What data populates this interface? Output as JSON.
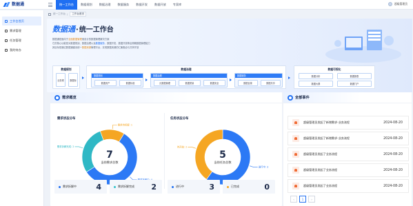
{
  "app": {
    "logo_text": "数据通"
  },
  "topnav": {
    "items": [
      "统一工作台",
      "数据规划",
      "数据治理",
      "数据服务",
      "数据开发",
      "数据开放",
      "专家库"
    ],
    "active_index": 0
  },
  "user": {
    "name": "超级管理员"
  },
  "sidebar": {
    "items": [
      {
        "label": "工作台首页",
        "icon": "home-icon",
        "active": true
      },
      {
        "label": "需求管理",
        "icon": "clipboard-icon",
        "active": false
      },
      {
        "label": "任务管理",
        "icon": "task-icon",
        "active": false
      },
      {
        "label": "我的待办",
        "icon": "todo-icon",
        "active": false
      }
    ]
  },
  "breadcrumb": {
    "items": [
      "统一工作台",
      "/"
    ],
    "current": "工作台首页"
  },
  "hero": {
    "title_main": "数据通",
    "title_sep": "·",
    "title_rest": "统一工作台",
    "desc_line1_a": "数据通是面向于",
    "desc_line1_hl": "全面数据管理",
    "desc_line1_b": "而设计的数据管理解决方案",
    "desc_line2_a": "它的核心功能是对数据规划、数据治理以及",
    "desc_line2_hl": "数据服务",
    "desc_line2_b": "、数据开发、数据开放等全周期数据管理能力",
    "desc_line3_a": "其目标是通过数据通建设统一",
    "desc_line3_hl": "数据资源",
    "desc_line3_b": "管理平台，实现数据资源的汇聚融合与共享开放",
    "flow": {
      "planning": {
        "title": "数据规划",
        "boxes": [
          "业务规划",
          "数据标准"
        ]
      },
      "governance_title": "数据治理",
      "sub1": {
        "title": "数据规划",
        "boxes": [
          "数据资产",
          "数据标准"
        ]
      },
      "sub2": {
        "title": "数据治理",
        "boxes": [
          "元数据管理",
          "数据质量",
          "数据安全"
        ]
      },
      "sub3": {
        "title": "数据服务",
        "boxes": [
          "数据目录",
          "数据共享"
        ]
      },
      "visible": {
        "title": "数据可视化",
        "boxes": [
          "数据分析",
          "数据大屏",
          "数据报表",
          "数据门户"
        ]
      }
    }
  },
  "overview": {
    "card_title": "需求概览",
    "demand_chart_title": "需求状态分布",
    "task_chart_title": "任务状态分布",
    "stats": [
      {
        "label": "需求拆解中",
        "value": "4",
        "color": "#1f6ff2"
      },
      {
        "label": "需求拆解完成",
        "value": "2",
        "color": "#2fc1c9"
      },
      {
        "label": "进行中",
        "value": "3",
        "color": "#1f6ff2"
      },
      {
        "label": "已完成",
        "value": "0",
        "color": "#f5a623"
      }
    ]
  },
  "chart_data": [
    {
      "type": "pie",
      "title": "需求状态分布",
      "center_value": "7",
      "center_label": "当前需求总数",
      "series": [
        {
          "name": "需求拆解中",
          "value": 4,
          "color": "#2c79f5",
          "label": "需求拆解中: 4"
        },
        {
          "name": "需求拆解完成",
          "value": 2,
          "color": "#2fb8c5",
          "label": "需求拆解完成: 2"
        },
        {
          "name": "需求待拆解",
          "value": 1,
          "color": "#f5a623",
          "label": "需求待拆解: 1"
        }
      ]
    },
    {
      "type": "pie",
      "title": "任务状态分布",
      "center_value": "5",
      "center_label": "当前任务总数",
      "series": [
        {
          "name": "进行中",
          "value": 3,
          "color": "#2c79f5",
          "label": "进行中: 3"
        },
        {
          "name": "待开始",
          "value": 2,
          "color": "#f5a623",
          "label": "待开始: 2"
        }
      ]
    }
  ],
  "events": {
    "card_title": "全部事件",
    "items": [
      {
        "text": "超级管理员发起了新增需求-业务流程",
        "date": "2024-08-20"
      },
      {
        "text": "超级管理员发起了新增需求-业务流程",
        "date": "2024-08-20"
      },
      {
        "text": "超级管理员发起了业务流程",
        "date": "2024-08-20"
      },
      {
        "text": "超级管理员发起了业务流程",
        "date": "2024-08-20"
      },
      {
        "text": "超级管理员发起了业务流程",
        "date": "2024-08-20"
      }
    ],
    "pager": {
      "prev": "‹",
      "current": "1",
      "next": "›"
    }
  }
}
